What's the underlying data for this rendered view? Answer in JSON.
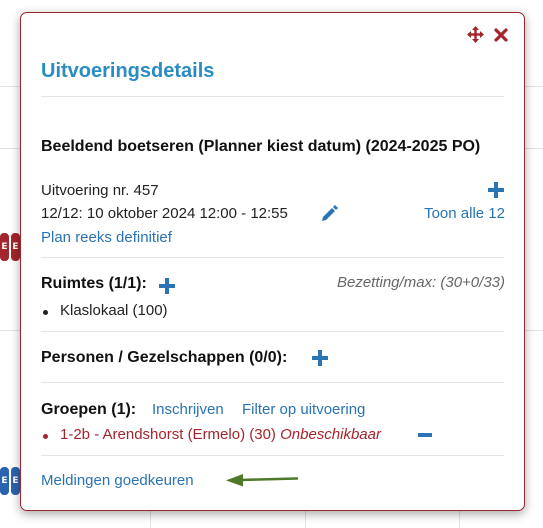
{
  "popup": {
    "title": "Uitvoeringsdetails",
    "course_title": "Beeldend boetseren (Planner kiest datum) (2024-2025 PO)",
    "execution_number": "Uitvoering nr. 457",
    "schedule": "12/12: 10 oktober 2024 12:00 - 12:55",
    "show_all_link": "Toon alle 12",
    "plan_series_link": "Plan reeks definitief",
    "rooms": {
      "heading": "Ruimtes (1/1):",
      "occupancy": "Bezetting/max: (30+0/33)",
      "items": [
        "Klaslokaal (100)"
      ]
    },
    "persons": {
      "heading": "Personen / Gezelschappen (0/0):"
    },
    "groups": {
      "heading": "Groepen (1):",
      "enroll_link": "Inschrijven",
      "filter_link": "Filter op uitvoering",
      "items": [
        {
          "label": "1-2b - Arendshorst (Ermelo) (30)",
          "status": "Onbeschikbaar"
        }
      ]
    },
    "approve_link": "Meldingen goedkeuren"
  },
  "background": {
    "badge_letter": "E"
  },
  "colors": {
    "accent": "#2b8cc4",
    "link": "#2a73b4",
    "danger": "#a4252b",
    "border": "#9b2730",
    "arrow": "#4f7a2a"
  },
  "icons": {
    "move": "move-icon",
    "close": "close-icon",
    "edit": "pencil-icon",
    "add": "plus-icon",
    "remove": "minus-icon",
    "arrow": "arrow-left-icon"
  }
}
